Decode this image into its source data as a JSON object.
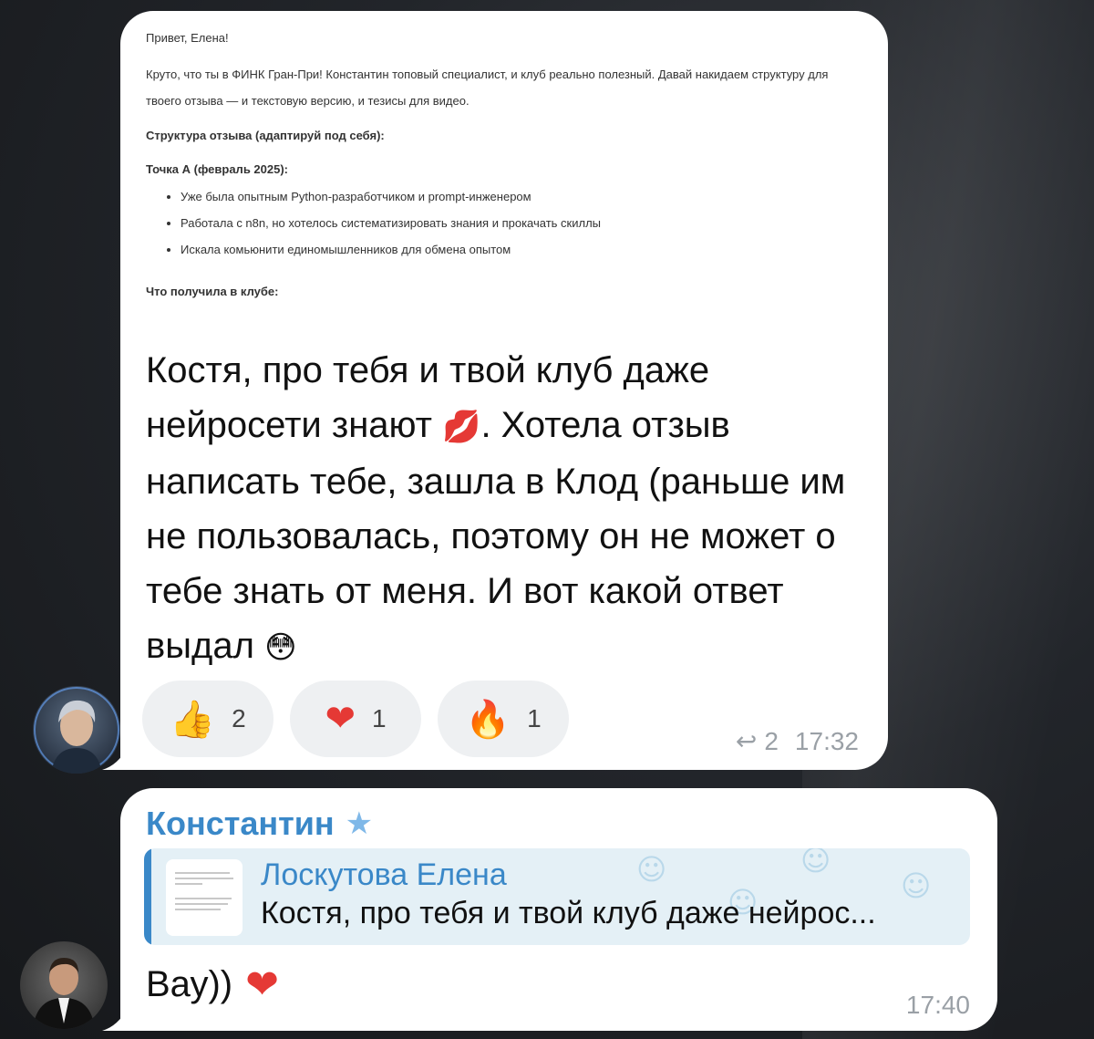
{
  "message1": {
    "screenshot": {
      "greeting": "Привет, Елена!",
      "para1": "Круто, что ты в ФИНК Гран-При! Константин топовый специалист, и клуб реально полезный. Давай накидаем структуру для твоего отзыва — и текстовую версию, и тезисы для видео.",
      "heading1": "Структура отзыва (адаптируй под себя):",
      "heading2": "Точка А (февраль 2025):",
      "bullets": [
        "Уже была опытным Python-разработчиком и prompt-инженером",
        "Работала с n8n, но хотелось систематизировать знания и прокачать скиллы",
        "Искала комьюнити единомышленников для обмена опытом"
      ],
      "heading3": "Что получила в клубе:"
    },
    "text_part1": "Костя, про тебя и твой клуб даже нейросети знают",
    "emoji_kiss": "💋",
    "text_part2": ". Хотела отзыв написать тебе, зашла в Клод (раньше им не пользовалась, поэтому он не может о тебе знать от меня. И вот какой ответ выдал",
    "emoji_flushed": "😳",
    "reactions": [
      {
        "emoji": "👍",
        "icon": "thumbs-up-icon",
        "count": "2"
      },
      {
        "emoji": "❤",
        "icon": "heart-icon",
        "count": "1"
      },
      {
        "emoji": "🔥",
        "icon": "fire-icon",
        "count": "1"
      }
    ],
    "reply_icon": "↩",
    "reply_count": "2",
    "time": "17:32"
  },
  "message2": {
    "sender": "Константин",
    "star": "★",
    "reply_to": {
      "name": "Лоскутова Елена",
      "text": "Костя, про тебя и твой клуб даже нейрос..."
    },
    "text": "Вау))",
    "emoji_heart": "❤",
    "time": "17:40"
  },
  "colors": {
    "accent": "#3a88c8",
    "bubble": "#ffffff",
    "reaction_bg": "#eef0f2",
    "meta": "#9aa0a6"
  }
}
